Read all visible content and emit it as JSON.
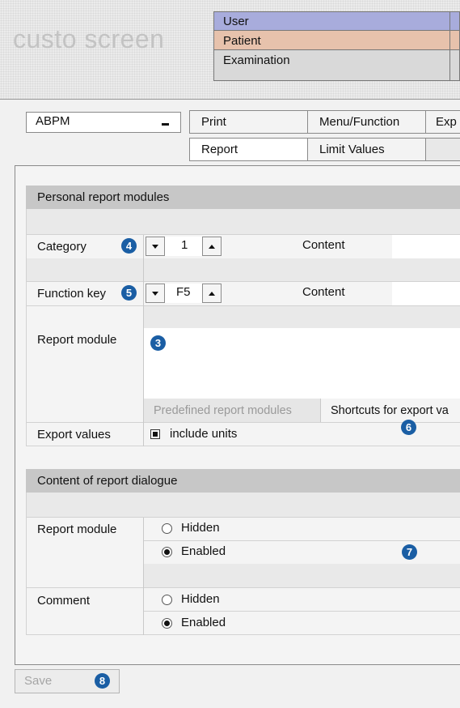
{
  "app": {
    "logo": "custo screen"
  },
  "info_rows": [
    {
      "label": "User",
      "color": "#a8acdc"
    },
    {
      "label": "Patient",
      "color": "#e7c2ac"
    },
    {
      "label": "Examination",
      "color": "#d9d9d9"
    }
  ],
  "module_select": {
    "value": "ABPM"
  },
  "tabs_top": [
    "Print",
    "Menu/Function",
    "Exp"
  ],
  "tabs_bottom": [
    "Report",
    "Limit Values"
  ],
  "personal": {
    "header": "Personal report modules",
    "category_label": "Category",
    "category_badge": "4",
    "category_value": "1",
    "content_label_1": "Content",
    "function_key_label": "Function key",
    "function_key_badge": "5",
    "function_key_value": "F5",
    "content_label_2": "Content",
    "report_module_label": "Report module",
    "report_module_badge": "3",
    "predefined_button": "Predefined report modules",
    "shortcuts_button": "Shortcuts for export va",
    "export_values_label": "Export values",
    "include_units_label": "include units",
    "shortcuts_badge": "6"
  },
  "dialogue": {
    "header": "Content of report dialogue",
    "report_module_label": "Report module",
    "hidden_label": "Hidden",
    "enabled_label": "Enabled",
    "dialogue_badge": "7",
    "comment_label": "Comment",
    "comment_hidden_label": "Hidden",
    "comment_enabled_label": "Enabled"
  },
  "footer": {
    "save_label": "Save",
    "save_badge": "8"
  }
}
